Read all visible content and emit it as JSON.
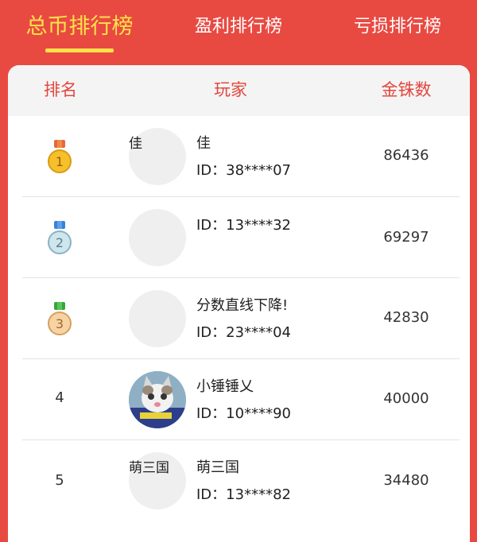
{
  "tabs": [
    {
      "label": "总币排行榜",
      "active": true
    },
    {
      "label": "盈利排行榜",
      "active": false
    },
    {
      "label": "亏损排行榜",
      "active": false
    }
  ],
  "colors": {
    "brand_red": "#e84a42",
    "active_yellow": "#ffe14a",
    "header_text": "#e2473f"
  },
  "table": {
    "headers": {
      "rank": "排名",
      "player": "玩家",
      "coins": "金铢数"
    },
    "rows": [
      {
        "rank": "1",
        "medal": "gold",
        "avatar_text": "佳",
        "name": "佳",
        "id": "ID：38****07",
        "coins": "86436"
      },
      {
        "rank": "2",
        "medal": "silver",
        "avatar_text": "",
        "name": "",
        "id": "ID：13****32",
        "coins": "69297"
      },
      {
        "rank": "3",
        "medal": "bronze",
        "avatar_text": "",
        "name": "分数直线下降!",
        "id": "ID：23****04",
        "coins": "42830"
      },
      {
        "rank": "4",
        "medal": "",
        "avatar_text": "",
        "avatar_icon": "cat-photo",
        "name": "小锤锤乂",
        "id": "ID：10****90",
        "coins": "40000"
      },
      {
        "rank": "5",
        "medal": "",
        "avatar_text": "萌三国",
        "name": "萌三国",
        "id": "ID：13****82",
        "coins": "34480"
      }
    ]
  }
}
